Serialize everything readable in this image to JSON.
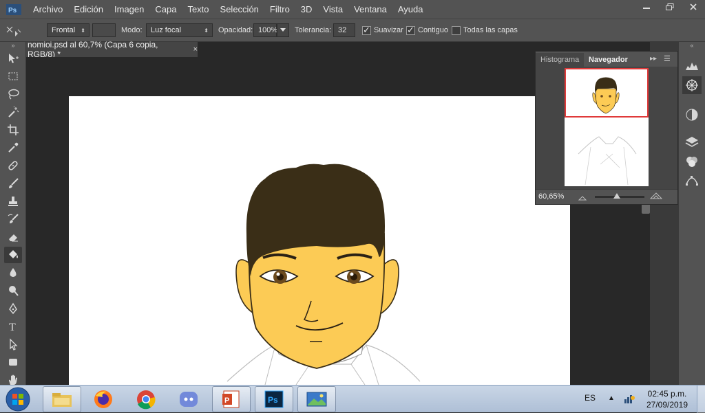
{
  "menu": [
    "Archivo",
    "Edición",
    "Imagen",
    "Capa",
    "Texto",
    "Selección",
    "Filtro",
    "3D",
    "Vista",
    "Ventana",
    "Ayuda"
  ],
  "window_controls": [
    "minimize-icon",
    "restore-icon",
    "close-icon"
  ],
  "options": {
    "brush_mode_value": "Frontal",
    "mode_label": "Modo:",
    "mode_value": "Luz focal",
    "opacity_label": "Opacidad:",
    "opacity_value": "100%",
    "tolerance_label": "Tolerancia:",
    "tolerance_value": "32",
    "smooth_label": "Suavizar",
    "contiguous_label": "Contiguo",
    "all_layers_label": "Todas las capas"
  },
  "document": {
    "tab_title": "nomioi.psd al 60,7% (Capa 6 copia, RGB/8) *"
  },
  "navigator": {
    "tab_histogram": "Histograma",
    "tab_navigator": "Navegador",
    "zoom_value": "60,65%",
    "zoom_level": 0.6065
  },
  "taskbar": {
    "language": "ES",
    "time": "02:45 p.m.",
    "date": "27/09/2019"
  },
  "colors": {
    "skin": "#fccb55",
    "hair": "#3a2e17",
    "ui_dark": "#535353",
    "nav_frame": "#e03a3a"
  }
}
